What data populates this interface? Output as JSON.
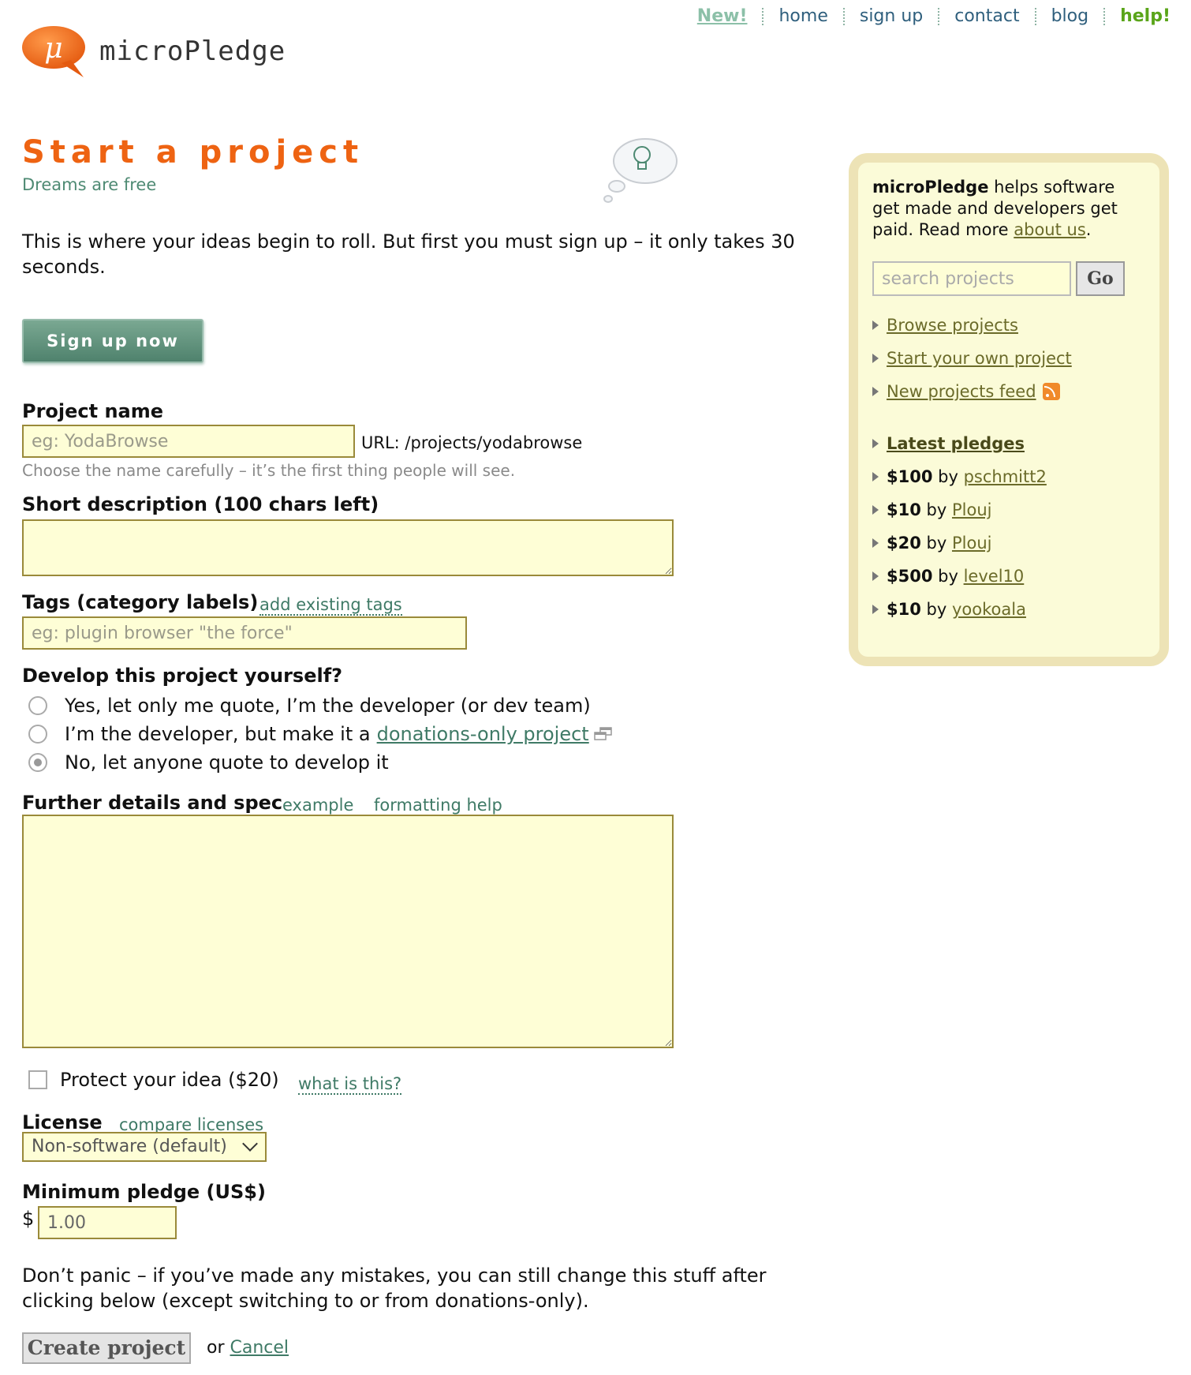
{
  "nav": {
    "new": "New!",
    "home": "home",
    "sign_up": "sign up",
    "contact": "contact",
    "blog": "blog",
    "help": "help!"
  },
  "logo": {
    "text": "microPledge",
    "glyph": "μ"
  },
  "page": {
    "title": "Start a project",
    "subtitle": "Dreams are free",
    "intro": "This is where your ideas begin to roll. But first you must sign up – it only takes 30 seconds.",
    "signup_label": "Sign up now"
  },
  "form": {
    "project_name": {
      "label": "Project name",
      "placeholder": "eg: YodaBrowse",
      "url": "URL: /projects/yodabrowse",
      "hint": "Choose the name carefully – it’s the first thing people will see."
    },
    "short_description": {
      "label": "Short description (100 chars left)"
    },
    "tags": {
      "label": "Tags (category labels)",
      "link": "add existing tags",
      "placeholder": "eg: plugin browser \"the force\""
    },
    "develop": {
      "label": "Develop this project yourself?",
      "option1": "Yes, let only me quote, I’m the developer (or dev team)",
      "option2_prefix": "I’m the developer, but make it a",
      "option2_link": "donations-only project",
      "option3": "No, let anyone quote to develop it"
    },
    "details": {
      "label": "Further details and spec",
      "example": "example",
      "formatting": "formatting help"
    },
    "protect": {
      "label": "Protect your idea ($20)",
      "link": "what is this?"
    },
    "license": {
      "label": "License",
      "link": "compare licenses",
      "selected": "Non-software (default)"
    },
    "minimum": {
      "label": "Minimum pledge (US$)",
      "currency": "$",
      "value": "1.00"
    },
    "note": "Don’t panic – if you’ve made any mistakes, you can still change this stuff after clicking below (except switching to or from donations-only).",
    "create_label": "Create project",
    "or": "or",
    "cancel": "Cancel"
  },
  "sidebar": {
    "brand": "microPledge",
    "intro_rest": "helps software get made and developers get paid. Read more",
    "about_link": "about us",
    "search_placeholder": "search projects",
    "go": "Go",
    "links": [
      "Browse projects",
      "Start your own project",
      "New projects feed"
    ],
    "latest_label": "Latest pledges",
    "pledges": [
      {
        "amount": "$100",
        "by": "by",
        "user": "pschmitt2"
      },
      {
        "amount": "$10",
        "by": "by",
        "user": "Plouj"
      },
      {
        "amount": "$20",
        "by": "by",
        "user": "Plouj"
      },
      {
        "amount": "$500",
        "by": "by",
        "user": "level10"
      },
      {
        "amount": "$10",
        "by": "by",
        "user": "yookoala"
      }
    ]
  },
  "colors": {
    "accent": "#ee6312",
    "green": "#4e8a73",
    "field_bg": "#fefed6",
    "sidebar_bg": "#fbfbd8"
  }
}
